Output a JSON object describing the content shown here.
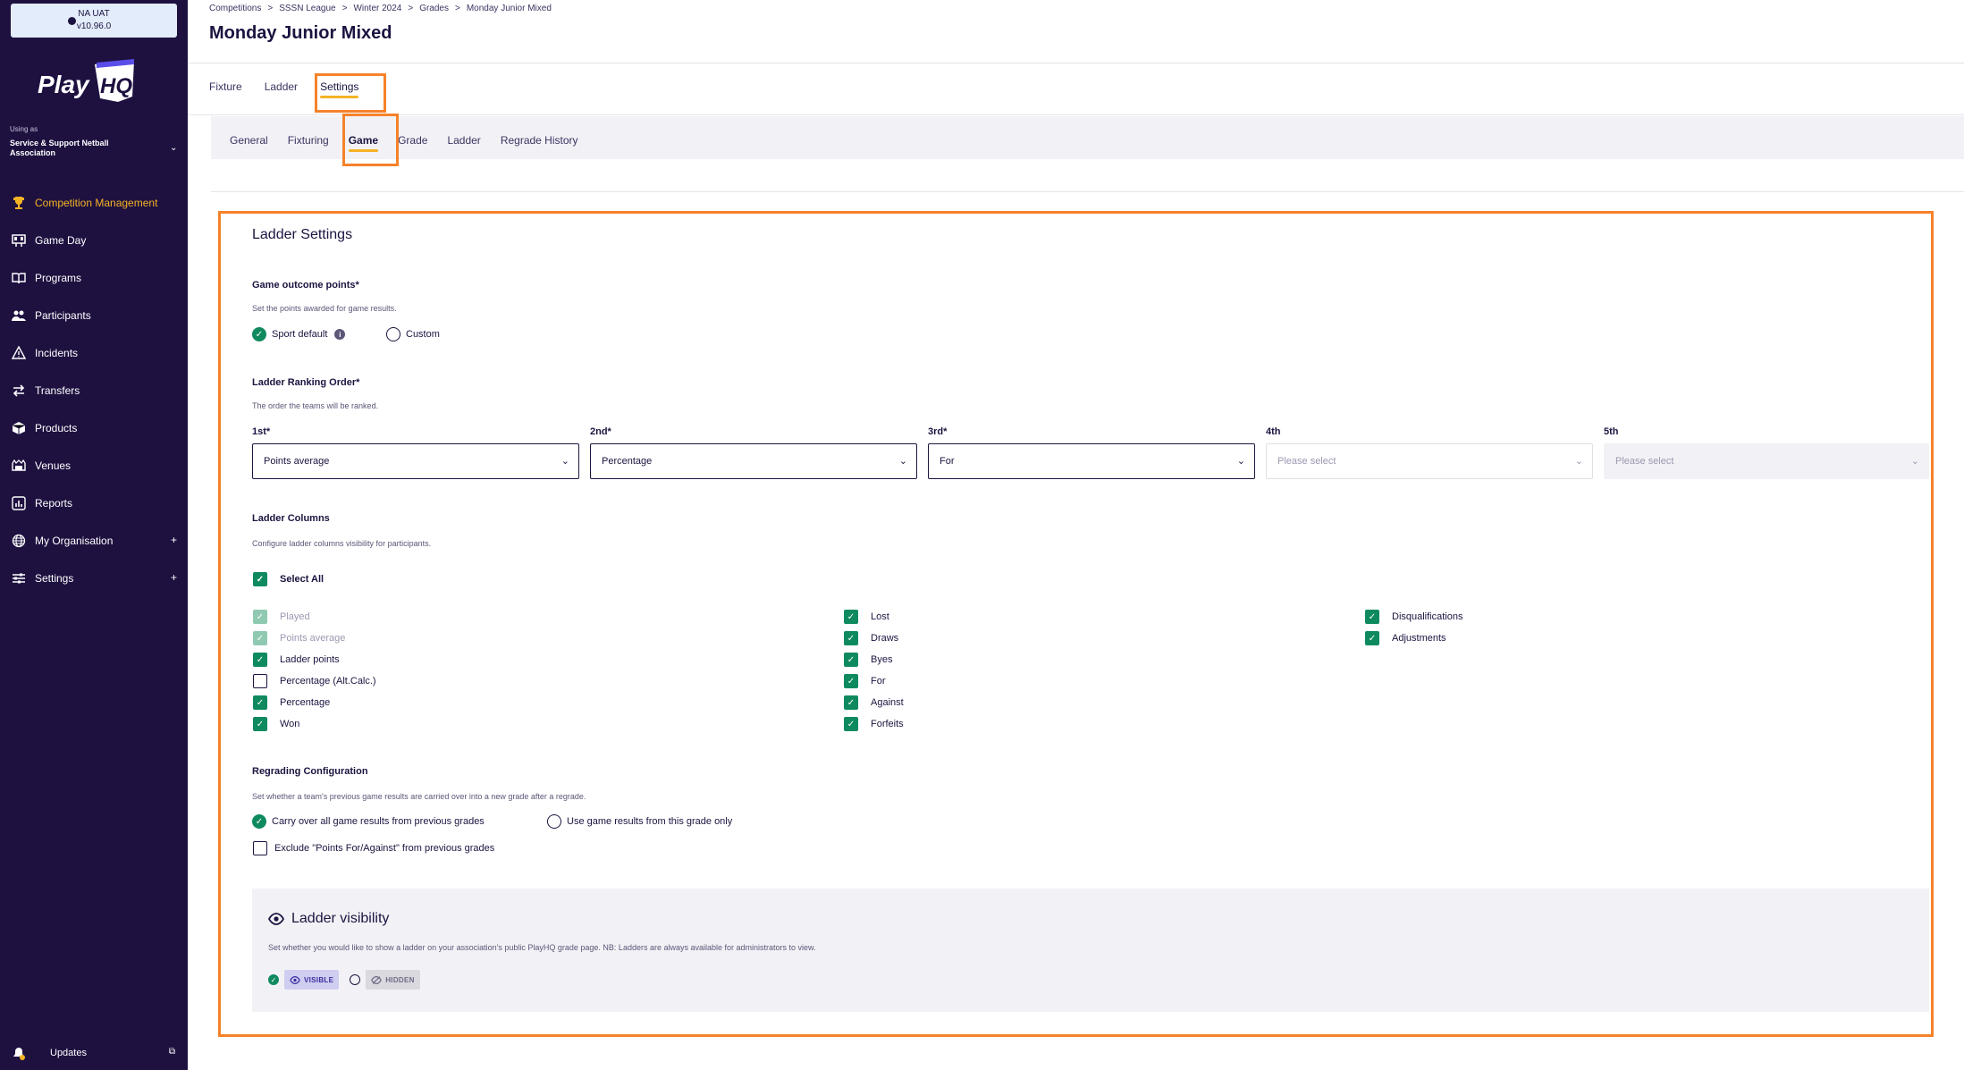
{
  "env": {
    "name": "NA UAT",
    "version": "v10.96.0"
  },
  "brand": {
    "logo_text": "Play",
    "logo_accent": "HQ"
  },
  "org": {
    "using_as": "Using as",
    "name": "Service & Support Netball Association"
  },
  "nav": {
    "items": [
      {
        "label": "Competition Management",
        "icon": "trophy-icon",
        "active": true
      },
      {
        "label": "Game Day",
        "icon": "scoreboard-icon"
      },
      {
        "label": "Programs",
        "icon": "book-icon"
      },
      {
        "label": "Participants",
        "icon": "users-icon"
      },
      {
        "label": "Incidents",
        "icon": "warning-icon"
      },
      {
        "label": "Transfers",
        "icon": "transfer-arrows-icon"
      },
      {
        "label": "Products",
        "icon": "box-icon"
      },
      {
        "label": "Venues",
        "icon": "stadium-icon"
      },
      {
        "label": "Reports",
        "icon": "report-icon"
      },
      {
        "label": "My Organisation",
        "icon": "globe-icon",
        "expandable": true
      },
      {
        "label": "Settings",
        "icon": "sliders-icon",
        "expandable": true
      }
    ],
    "updates": "Updates"
  },
  "breadcrumb": [
    "Competitions",
    "SSSN League",
    "Winter 2024",
    "Grades",
    "Monday Junior Mixed"
  ],
  "breadcrumb_sep": ">",
  "page_title": "Monday Junior Mixed",
  "tabs": [
    {
      "label": "Fixture"
    },
    {
      "label": "Ladder"
    },
    {
      "label": "Settings",
      "active": true
    }
  ],
  "subtabs": [
    {
      "label": "General"
    },
    {
      "label": "Fixturing"
    },
    {
      "label": "Game",
      "active": true
    },
    {
      "label": "Grade"
    },
    {
      "label": "Ladder"
    },
    {
      "label": "Regrade History"
    }
  ],
  "ladder_settings": {
    "title": "Ladder Settings",
    "game_outcome": {
      "label": "Game outcome points*",
      "help": "Set the points awarded for game results.",
      "options": [
        "Sport default",
        "Custom"
      ],
      "selected": "Sport default"
    },
    "ranking": {
      "label": "Ladder Ranking Order*",
      "help": "The order the teams will be ranked.",
      "slots": [
        {
          "label": "1st*",
          "value": "Points average"
        },
        {
          "label": "2nd*",
          "value": "Percentage"
        },
        {
          "label": "3rd*",
          "value": "For"
        },
        {
          "label": "4th",
          "value": "Please select"
        },
        {
          "label": "5th",
          "value": "Please select"
        }
      ]
    },
    "columns": {
      "label": "Ladder Columns",
      "help": "Configure ladder columns visibility for participants.",
      "select_all": "Select All",
      "col1": [
        {
          "label": "Played",
          "checked": true,
          "disabled": true
        },
        {
          "label": "Points average",
          "checked": true,
          "disabled": true
        },
        {
          "label": "Ladder points",
          "checked": true
        },
        {
          "label": "Percentage (Alt.Calc.)",
          "checked": false
        },
        {
          "label": "Percentage",
          "checked": true
        },
        {
          "label": "Won",
          "checked": true
        }
      ],
      "col2": [
        {
          "label": "Lost",
          "checked": true
        },
        {
          "label": "Draws",
          "checked": true
        },
        {
          "label": "Byes",
          "checked": true
        },
        {
          "label": "For",
          "checked": true
        },
        {
          "label": "Against",
          "checked": true
        },
        {
          "label": "Forfeits",
          "checked": true
        }
      ],
      "col3": [
        {
          "label": "Disqualifications",
          "checked": true
        },
        {
          "label": "Adjustments",
          "checked": true
        }
      ]
    },
    "regrading": {
      "label": "Regrading Configuration",
      "help": "Set whether a team's previous game results are carried over into a new grade after a regrade.",
      "options": [
        "Carry over all game results from previous grades",
        "Use game results from this grade only"
      ],
      "selected": "Carry over all game results from previous grades",
      "exclude_label": "Exclude \"Points For/Against\" from previous grades"
    },
    "visibility": {
      "title": "Ladder visibility",
      "help": "Set whether you would like to show a ladder on your association's public PlayHQ grade page. NB: Ladders are always available for administrators to view.",
      "visible_label": "VISIBLE",
      "hidden_label": "HIDDEN",
      "selected": "VISIBLE"
    }
  },
  "colors": {
    "sidebar": "#1e1140",
    "accent": "#f5b324",
    "highlight": "#f5822a",
    "check": "#0f8a5f"
  }
}
